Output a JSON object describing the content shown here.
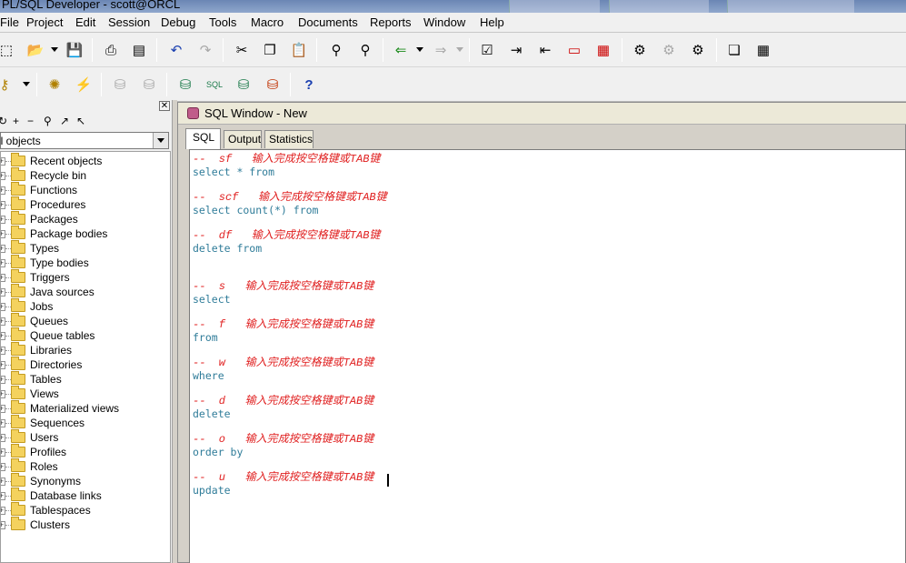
{
  "window": {
    "title": "PL/SQL Developer - scott@ORCL"
  },
  "menu": [
    "File",
    "Project",
    "Edit",
    "Session",
    "Debug",
    "Tools",
    "Macro",
    "Documents",
    "Reports",
    "Window",
    "Help"
  ],
  "toolbar1_icons": [
    "new-icon",
    "open-icon",
    "save-icon",
    "print-icon",
    "print-preview-icon",
    "undo-icon",
    "redo-icon",
    "cut-icon",
    "copy-icon",
    "paste-icon",
    "find-icon",
    "find-next-icon",
    "import-icon",
    "export-icon",
    "beautify-icon",
    "indent-icon",
    "unindent-icon",
    "uppercase-icon",
    "lowercase-icon",
    "execute-icon",
    "stop-icon",
    "explain-icon",
    "tile-icon",
    "cascade-icon"
  ],
  "toolbar2_icons": [
    "key-icon",
    "compile-icon",
    "step-icon",
    "commit-icon",
    "rollback-icon",
    "db-connect-icon",
    "sql-icon",
    "db-browse-icon",
    "db-log-icon"
  ],
  "help_icon": "?",
  "browser": {
    "close_glyph": "✕",
    "tool_glyphs": [
      "↻",
      "+",
      "−",
      "⚲",
      "↗",
      "↖"
    ],
    "filter": "ll objects",
    "items": [
      "Recent objects",
      "Recycle bin",
      "Functions",
      "Procedures",
      "Packages",
      "Package bodies",
      "Types",
      "Type bodies",
      "Triggers",
      "Java sources",
      "Jobs",
      "Queues",
      "Queue tables",
      "Libraries",
      "Directories",
      "Tables",
      "Views",
      "Materialized views",
      "Sequences",
      "Users",
      "Profiles",
      "Roles",
      "Synonyms",
      "Database links",
      "Tablespaces",
      "Clusters"
    ]
  },
  "sql_window": {
    "title": "SQL Window - New",
    "tabs": [
      "SQL",
      "Output",
      "Statistics"
    ],
    "lines": [
      {
        "kind": "cmt",
        "text": "--  sf   输入完成按空格键或TAB键"
      },
      {
        "kind": "kw",
        "text": "select * from"
      },
      {
        "kind": "blank",
        "text": ""
      },
      {
        "kind": "cmt",
        "text": "--  scf   输入完成按空格键或TAB键"
      },
      {
        "kind": "kw",
        "text": "select count(*) from"
      },
      {
        "kind": "blank",
        "text": ""
      },
      {
        "kind": "cmt",
        "text": "--  df   输入完成按空格键或TAB键"
      },
      {
        "kind": "kw",
        "text": "delete from"
      },
      {
        "kind": "blank",
        "text": ""
      },
      {
        "kind": "blank",
        "text": ""
      },
      {
        "kind": "cmt",
        "text": "--  s   输入完成按空格键或TAB键"
      },
      {
        "kind": "kw",
        "text": "select"
      },
      {
        "kind": "blank",
        "text": ""
      },
      {
        "kind": "cmt",
        "text": "--  f   输入完成按空格键或TAB键"
      },
      {
        "kind": "kw",
        "text": "from"
      },
      {
        "kind": "blank",
        "text": ""
      },
      {
        "kind": "cmt",
        "text": "--  w   输入完成按空格键或TAB键"
      },
      {
        "kind": "kw",
        "text": "where"
      },
      {
        "kind": "blank",
        "text": ""
      },
      {
        "kind": "cmt",
        "text": "--  d   输入完成按空格键或TAB键"
      },
      {
        "kind": "kw",
        "text": "delete"
      },
      {
        "kind": "blank",
        "text": ""
      },
      {
        "kind": "cmt",
        "text": "--  o   输入完成按空格键或TAB键"
      },
      {
        "kind": "kw",
        "text": "order by"
      },
      {
        "kind": "blank",
        "text": ""
      },
      {
        "kind": "cmt",
        "text": "--  u   输入完成按空格键或TAB键"
      },
      {
        "kind": "kw",
        "text": "update"
      }
    ]
  },
  "colors": {
    "comment": "#e02020",
    "keyword": "#2f7c99"
  }
}
